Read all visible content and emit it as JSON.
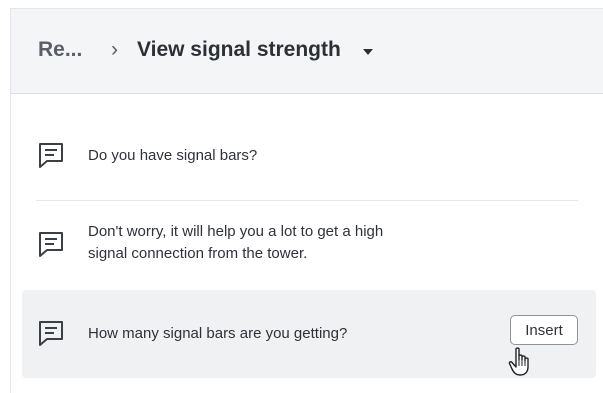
{
  "header": {
    "breadcrumb": "Re...",
    "separator": "›",
    "title": "View signal strength"
  },
  "items": [
    {
      "text": "Do you have signal bars?"
    },
    {
      "text_lines": [
        "Don't worry, it will help you a lot to get a high",
        "signal connection from the tower."
      ]
    },
    {
      "text": "How many signal bars are you getting?",
      "action_label": "Insert"
    }
  ],
  "icons": [
    "message-icon",
    "message-icon",
    "message-icon",
    "hand-pointer-cursor-icon"
  ]
}
